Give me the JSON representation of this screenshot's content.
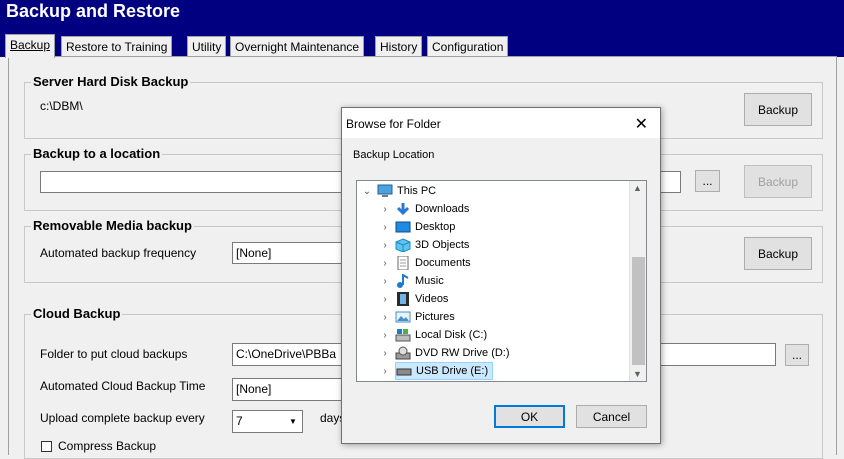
{
  "window": {
    "title": "Backup and Restore"
  },
  "tabs": [
    "Backup",
    "Restore to Training",
    "Utility",
    "Overnight Maintenance",
    "History",
    "Configuration"
  ],
  "server": {
    "label": "Server Hard Disk Backup",
    "path": "c:\\DBM\\",
    "button": "Backup"
  },
  "location": {
    "label": "Backup to a location",
    "value": "",
    "browse": "...",
    "button": "Backup"
  },
  "removable": {
    "label": "Removable Media backup",
    "freq_label": "Automated backup frequency",
    "freq_value": "[None]",
    "button": "Backup"
  },
  "cloud": {
    "label": "Cloud Backup",
    "folder_label": "Folder to put cloud backups",
    "folder_value": "C:\\OneDrive\\PBBa",
    "browse": "...",
    "time_label": "Automated Cloud Backup Time",
    "time_value": "[None]",
    "upload_label": "Upload complete backup every",
    "upload_value": "7",
    "upload_unit": "days",
    "compress_label": "Compress Backup"
  },
  "dialog": {
    "title": "Browse for Folder",
    "close": "✕",
    "label": "Backup Location",
    "tree": [
      {
        "label": "This PC",
        "icon": "computer-icon",
        "expanded": true
      },
      {
        "label": "Downloads",
        "icon": "downloads-icon"
      },
      {
        "label": "Desktop",
        "icon": "desktop-icon"
      },
      {
        "label": "3D Objects",
        "icon": "3d-objects-icon"
      },
      {
        "label": "Documents",
        "icon": "documents-icon"
      },
      {
        "label": "Music",
        "icon": "music-icon"
      },
      {
        "label": "Videos",
        "icon": "videos-icon"
      },
      {
        "label": "Pictures",
        "icon": "pictures-icon"
      },
      {
        "label": "Local Disk (C:)",
        "icon": "local-disk-icon"
      },
      {
        "label": "DVD RW Drive (D:)",
        "icon": "dvd-drive-icon"
      },
      {
        "label": "USB Drive (E:)",
        "icon": "usb-drive-icon",
        "selected": true
      }
    ],
    "ok": "OK",
    "cancel": "Cancel"
  },
  "colors": {
    "titlebar": "#000080",
    "selection": "#cce8ff",
    "accent": "#0078d7"
  }
}
